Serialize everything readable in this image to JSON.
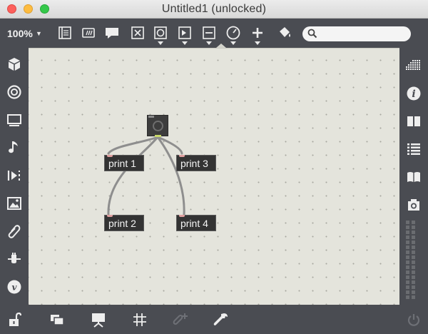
{
  "window": {
    "title": "Untitled1 (unlocked)"
  },
  "toolbar": {
    "zoom": "100%",
    "search_placeholder": "",
    "buttons": [
      "bpatcher-icon",
      "message-icon",
      "comment-icon",
      "toggle-icon",
      "button-icon",
      "number-icon",
      "slider-icon",
      "dial-icon",
      "add-icon",
      "paint-bucket-icon"
    ]
  },
  "left_sidebar": {
    "items": [
      "cube-icon",
      "target-icon",
      "display-icon",
      "music-note-icon",
      "transport-icon",
      "image-icon",
      "paperclip-icon",
      "plug-icon",
      "vimeo-icon"
    ]
  },
  "right_sidebar": {
    "items": [
      "grid-icon",
      "info-icon",
      "reference-icon",
      "list-icon",
      "book-icon",
      "camera-icon"
    ]
  },
  "bottom_bar": {
    "items": [
      "unlock-icon",
      "presentation-icon",
      "present-mode-icon",
      "grid-toggle-icon",
      "add-snippet-icon",
      "wrench-icon",
      "power-icon"
    ]
  },
  "patch": {
    "objects": [
      {
        "type": "button",
        "label": ""
      },
      {
        "type": "print",
        "label": "print 1"
      },
      {
        "type": "print",
        "label": "print 3"
      },
      {
        "type": "print",
        "label": "print 2"
      },
      {
        "type": "print",
        "label": "print 4"
      }
    ]
  },
  "colors": {
    "chrome": "#4a4c52",
    "canvas": "#e4e4dc",
    "object": "#333333",
    "patch_cord": "#909090",
    "outlet_active": "#c8d86a"
  }
}
